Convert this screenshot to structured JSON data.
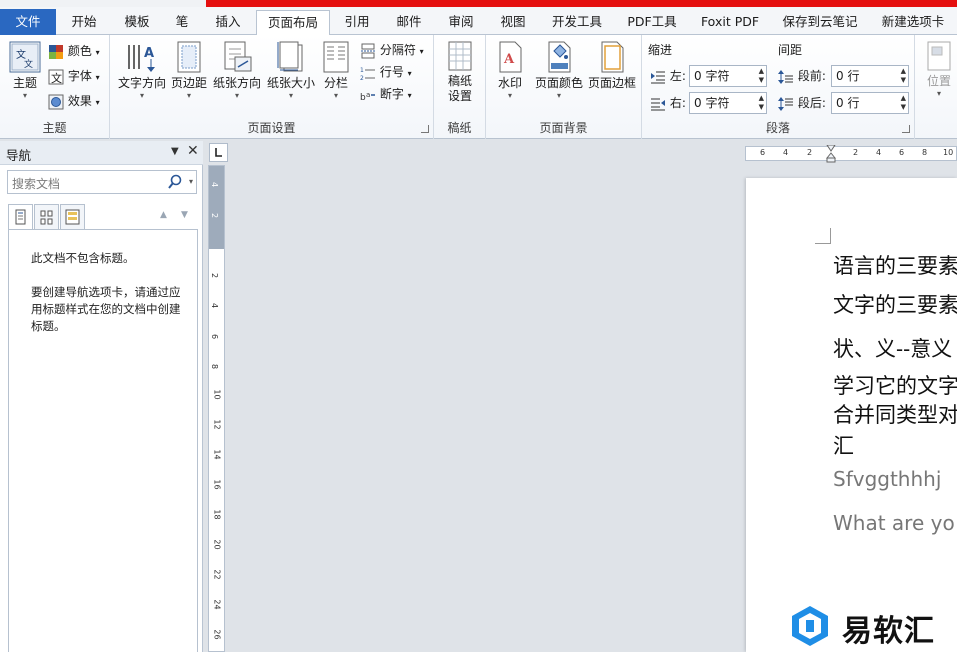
{
  "tabs": [
    "文件",
    "开始",
    "模板",
    "笔",
    "插入",
    "页面布局",
    "引用",
    "邮件",
    "审阅",
    "视图",
    "开发工具",
    "PDF工具",
    "Foxit PDF",
    "保存到云笔记",
    "新建选项卡"
  ],
  "active_tab": "页面布局",
  "ribbon": {
    "theme": {
      "label": "主题",
      "theme_btn": "主题",
      "colors": "颜色",
      "fonts": "字体",
      "effects": "效果"
    },
    "page_setup": {
      "label": "页面设置",
      "text_direction": "文字方向",
      "margins": "页边距",
      "orientation": "纸张方向",
      "size": "纸张大小",
      "columns": "分栏",
      "breaks": "分隔符",
      "line_numbers": "行号",
      "hyphenation": "断字"
    },
    "manuscript": {
      "label": "稿纸",
      "setup_line1": "稿纸",
      "setup_line2": "设置"
    },
    "page_background": {
      "label": "页面背景",
      "watermark": "水印",
      "page_color": "页面颜色",
      "page_borders": "页面边框"
    },
    "paragraph": {
      "label": "段落",
      "indent": "缩进",
      "spacing": "间距",
      "left": "左:",
      "right": "右:",
      "before": "段前:",
      "after": "段后:",
      "left_val": "0 字符",
      "right_val": "0 字符",
      "before_val": "0 行",
      "after_val": "0 行"
    },
    "arrange": {
      "position": "位置"
    }
  },
  "nav": {
    "title": "导航",
    "search_placeholder": "搜索文档",
    "no_headings": "此文档不包含标题。",
    "hint": "要创建导航选项卡，请通过应用标题样式在您的文档中创建标题。"
  },
  "ruler": {
    "h_ticks": [
      "6",
      "4",
      "2",
      "2",
      "4",
      "6",
      "8",
      "10"
    ],
    "v_ticks": [
      "4",
      "2",
      "2",
      "4",
      "6",
      "8",
      "10",
      "12",
      "14",
      "16",
      "18",
      "20",
      "22",
      "24",
      "26"
    ]
  },
  "document": {
    "lines": [
      "语言的三要素",
      "文字的三要素",
      "状、义--意义",
      "学习它的文字",
      "合并同类型对",
      "汇",
      "Sfvggthhhj",
      "What are yo"
    ]
  },
  "watermark": {
    "text": "易软汇"
  }
}
